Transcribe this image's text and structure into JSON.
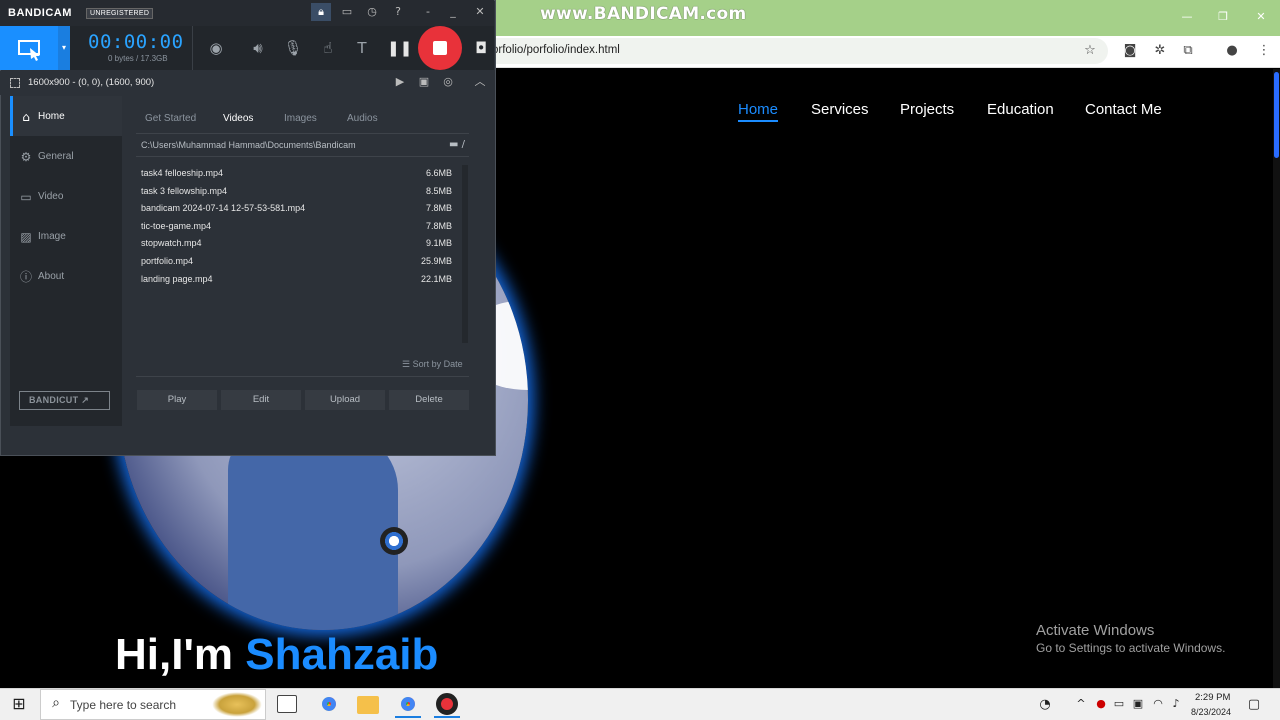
{
  "watermark": "www.BANDICAM.com",
  "browser": {
    "url": "orfolio/porfolio/index.html"
  },
  "site": {
    "nav": [
      "Home",
      "Services",
      "Projects",
      "Education",
      "Contact Me"
    ],
    "greeting": "Hi,I'm ",
    "name": "Shahzaib"
  },
  "activate": {
    "title": "Activate Windows",
    "subtitle": "Go to Settings to activate Windows."
  },
  "bandicam": {
    "logo": "BANDICAM",
    "badge": "UNREGISTERED",
    "timer": "00:00:00",
    "storage": "0 bytes / 17.3GB",
    "area": "1600x900 - (0, 0), (1600, 900)",
    "sidebar": [
      "Home",
      "General",
      "Video",
      "Image",
      "About"
    ],
    "bandicut": "BANDICUT",
    "tabs": [
      "Get Started",
      "Videos",
      "Images",
      "Audios"
    ],
    "path": "C:\\Users\\Muhammad Hammad\\Documents\\Bandicam",
    "path_suffix": "/",
    "files": [
      {
        "name": "task4 felloeship.mp4",
        "size": "6.6MB"
      },
      {
        "name": "task 3 fellowship.mp4",
        "size": "8.5MB"
      },
      {
        "name": "bandicam 2024-07-14 12-57-53-581.mp4",
        "size": "7.8MB"
      },
      {
        "name": "tic-toe-game.mp4",
        "size": "7.8MB"
      },
      {
        "name": "stopwatch.mp4",
        "size": "9.1MB"
      },
      {
        "name": "portfolio.mp4",
        "size": "25.9MB"
      },
      {
        "name": "landing page.mp4",
        "size": "22.1MB"
      }
    ],
    "sort": "Sort by Date",
    "actions": [
      "Play",
      "Edit",
      "Upload",
      "Delete"
    ]
  },
  "taskbar": {
    "search_placeholder": "Type here to search",
    "time": "2:29 PM",
    "date": "8/23/2024"
  },
  "colors": {
    "accent": "#1b8cff",
    "record": "#e8323a",
    "chrome_bar": "#a5d089"
  }
}
